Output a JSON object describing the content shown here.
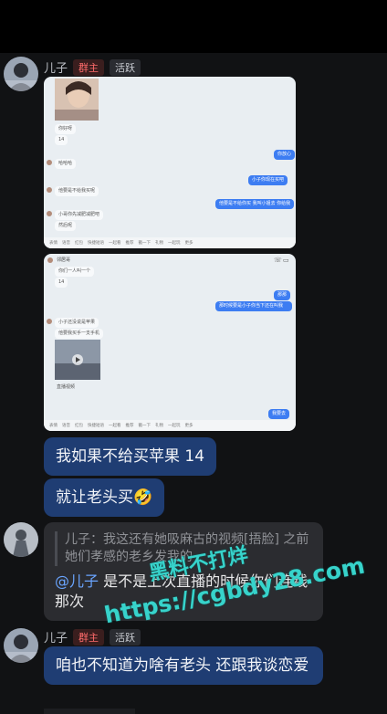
{
  "message1": {
    "sender": "儿子",
    "badge_owner": "群主",
    "badge_active": "活跃"
  },
  "screenshot1": {
    "bubbles_left": [
      "你好呀",
      "14",
      "哈哈哈",
      "他要是不给我买呢",
      "小哥你先减肥减肥吧",
      "然后呢"
    ],
    "bubbles_right": [
      "你放心",
      "小子你现在买吧",
      "他要是不给你买  我叫小姐去 你给我"
    ],
    "toolbar": [
      "表情",
      "语音",
      "红包",
      "快捷短语",
      "一起看",
      "推荐",
      "戳一下",
      "礼物",
      "一起玩",
      "更多"
    ]
  },
  "screenshot2": {
    "title": "邻居哥",
    "bubbles_left": [
      "你们一人叫一个",
      "14",
      "小子还没说是苹果",
      "他要我买手一支手机"
    ],
    "bubbles_right": [
      "那那",
      "那时候要是小子你当下还在叫我",
      "我要去"
    ],
    "video_caption": "直播视频",
    "toolbar": [
      "表情",
      "语音",
      "红包",
      "快捷短语",
      "一起看",
      "推荐",
      "戳一下",
      "礼物",
      "一起玩",
      "更多"
    ]
  },
  "message2": {
    "text": "我如果不给买苹果 14"
  },
  "message3": {
    "text": "就让老头买",
    "emoji": "🤣"
  },
  "message4": {
    "quote": "儿子：我这还有她吸麻古的视频[捂脸] 之前 她们孝感的老乡发我的",
    "mention": "@儿子",
    "text": " 是不是上次直播的时候你们连线那次"
  },
  "message5": {
    "sender": "儿子",
    "badge_owner": "群主",
    "badge_active": "活跃",
    "text": "咱也不知道为啥有老头 还跟我谈恋爱"
  },
  "watermark": {
    "line1": "黑料不打烊",
    "line2": "https://cgbdy28.com"
  },
  "colors": {
    "background": "#111214",
    "blue_bubble": "#1f3d73",
    "gray_bubble": "#2b2c30",
    "owner_badge": "#ff6b6b",
    "watermark": "#37d3cb"
  }
}
